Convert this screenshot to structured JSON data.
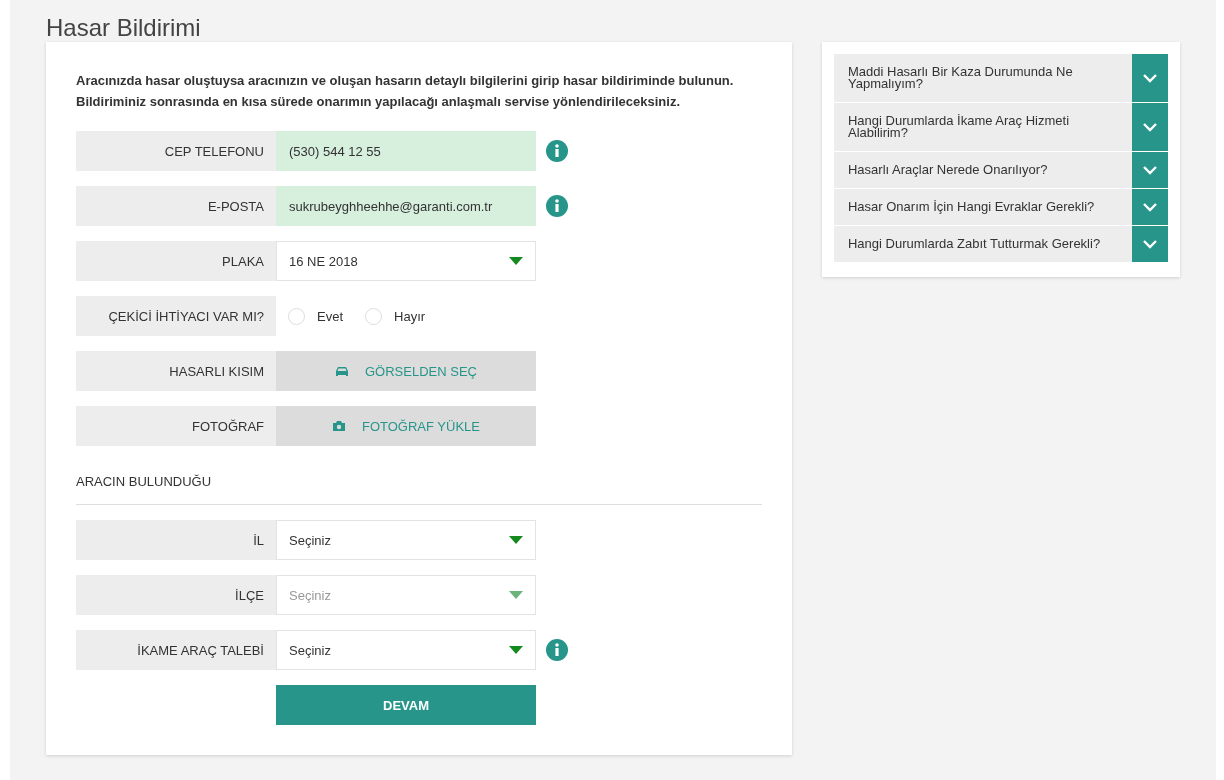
{
  "page_title": "Hasar Bildirimi",
  "intro": "Aracınızda hasar oluştuysa aracınızın ve oluşan hasarın detaylı bilgilerini girip hasar bildiriminde bulunun. Bildiriminiz sonrasında en kısa sürede onarımın yapılacağı anlaşmalı servise yönlendirileceksiniz.",
  "fields": [
    {
      "kind": "text",
      "label": "CEP TELEFONU",
      "value": "(530) 544 12 55",
      "valid": true,
      "info": true
    },
    {
      "kind": "text",
      "label": "E-POSTA",
      "value": "sukrubeyghheehhe@garanti.com.tr",
      "valid": true,
      "info": true
    },
    {
      "kind": "select",
      "label": "PLAKA",
      "value": "16 NE 2018",
      "disabled": false,
      "info": false
    },
    {
      "kind": "radio",
      "label": "ÇEKİCİ İHTİYACI VAR MI?",
      "options": [
        {
          "label": "Evet",
          "selected": false
        },
        {
          "label": "Hayır",
          "selected": false
        }
      ]
    },
    {
      "kind": "picker",
      "label": "HASARLI KISIM",
      "button": "GÖRSELDEN SEÇ"
    },
    {
      "kind": "upload",
      "label": "FOTOĞRAF",
      "button": "FOTOĞRAF YÜKLE"
    }
  ],
  "location": {
    "heading": "ARACIN BULUNDUĞU",
    "fields": [
      {
        "kind": "select",
        "label": "İL",
        "value": "Seçiniz",
        "disabled": false,
        "info": false
      },
      {
        "kind": "select",
        "label": "İLÇE",
        "value": "Seçiniz",
        "disabled": true,
        "info": false
      },
      {
        "kind": "select",
        "label": "İKAME ARAÇ TALEBİ",
        "value": "Seçiniz",
        "disabled": false,
        "info": true
      }
    ]
  },
  "submit": "DEVAM",
  "faq": [
    {
      "question": "Maddi Hasarlı Bir Kaza Durumunda Ne Yapmalıyım?",
      "expanded": false
    },
    {
      "question": "Hangi Durumlarda İkame Araç Hizmeti Alabilirim?",
      "expanded": false
    },
    {
      "question": "Hasarlı Araçlar Nerede Onarılıyor?",
      "expanded": false
    },
    {
      "question": "Hasar Onarım İçin Hangi Evraklar Gerekli?",
      "expanded": false
    },
    {
      "question": "Hangi Durumlarda Zabıt Tutturmak Gerekli?",
      "expanded": false
    }
  ]
}
